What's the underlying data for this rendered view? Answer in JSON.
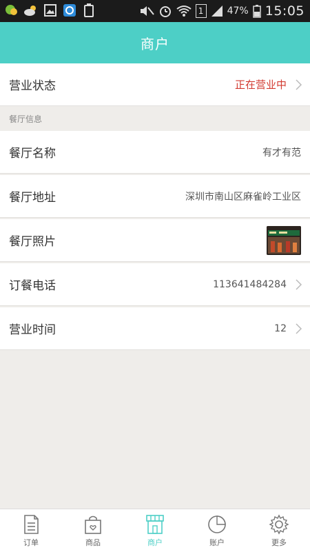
{
  "status_bar": {
    "battery_percent": "47%",
    "time": "15:05",
    "signal_badge": "1"
  },
  "header": {
    "title": "商户"
  },
  "business_status": {
    "label": "营业状态",
    "value": "正在营业中"
  },
  "section": {
    "title": "餐厅信息"
  },
  "info_rows": [
    {
      "label": "餐厅名称",
      "value": "有才有范"
    },
    {
      "label": "餐厅地址",
      "value": "深圳市南山区麻雀岭工业区"
    },
    {
      "label": "餐厅照片",
      "value": ""
    },
    {
      "label": "订餐电话",
      "value": "113641484284"
    },
    {
      "label": "营业时间",
      "value": "12"
    }
  ],
  "tabs": [
    {
      "label": "订单",
      "icon": "order-icon"
    },
    {
      "label": "商品",
      "icon": "goods-icon"
    },
    {
      "label": "商户",
      "icon": "store-icon",
      "active": true
    },
    {
      "label": "账户",
      "icon": "account-icon"
    },
    {
      "label": "更多",
      "icon": "settings-icon"
    }
  ],
  "colors": {
    "accent": "#4dcfc6",
    "status_red": "#d23a30"
  }
}
